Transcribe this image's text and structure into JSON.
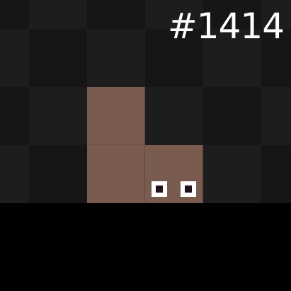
{
  "game": {
    "level_counter": "#1414"
  },
  "colors": {
    "background": "#000000",
    "tile_dark": "#161616",
    "tile_light": "#1d1d1d",
    "creature_body": "#7a5b50",
    "eye_white": "#ffffff",
    "pupil": "#22101c",
    "counter_text": "#ffffff"
  },
  "icons": {
    "eye": "eye-icon",
    "pupil": "pupil-icon"
  }
}
